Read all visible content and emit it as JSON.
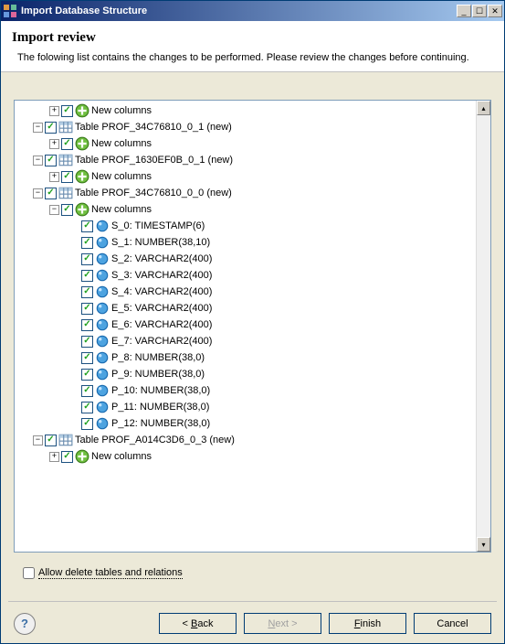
{
  "titlebar": {
    "title": "Import Database Structure"
  },
  "header": {
    "title": "Import review",
    "desc": "The folowing list contains the changes to be performed. Please review the changes before continuing."
  },
  "tree": [
    {
      "level": 2,
      "toggle": "+",
      "icon": "plus",
      "label": "New columns"
    },
    {
      "level": 1,
      "toggle": "-",
      "icon": "table",
      "label": "Table PROF_34C76810_0_1 (new)"
    },
    {
      "level": 2,
      "toggle": "+",
      "icon": "plus",
      "label": "New columns"
    },
    {
      "level": 1,
      "toggle": "-",
      "icon": "table",
      "label": "Table PROF_1630EF0B_0_1 (new)"
    },
    {
      "level": 2,
      "toggle": "+",
      "icon": "plus",
      "label": "New columns"
    },
    {
      "level": 1,
      "toggle": "-",
      "icon": "table",
      "label": "Table PROF_34C76810_0_0 (new)"
    },
    {
      "level": 2,
      "toggle": "-",
      "icon": "plus",
      "label": "New columns"
    },
    {
      "level": 3,
      "toggle": "",
      "icon": "column",
      "label": "S_0: TIMESTAMP(6)"
    },
    {
      "level": 3,
      "toggle": "",
      "icon": "column",
      "label": "S_1: NUMBER(38,10)"
    },
    {
      "level": 3,
      "toggle": "",
      "icon": "column",
      "label": "S_2: VARCHAR2(400)"
    },
    {
      "level": 3,
      "toggle": "",
      "icon": "column",
      "label": "S_3: VARCHAR2(400)"
    },
    {
      "level": 3,
      "toggle": "",
      "icon": "column",
      "label": "S_4: VARCHAR2(400)"
    },
    {
      "level": 3,
      "toggle": "",
      "icon": "column",
      "label": "E_5: VARCHAR2(400)"
    },
    {
      "level": 3,
      "toggle": "",
      "icon": "column",
      "label": "E_6: VARCHAR2(400)"
    },
    {
      "level": 3,
      "toggle": "",
      "icon": "column",
      "label": "E_7: VARCHAR2(400)"
    },
    {
      "level": 3,
      "toggle": "",
      "icon": "column",
      "label": "P_8: NUMBER(38,0)"
    },
    {
      "level": 3,
      "toggle": "",
      "icon": "column",
      "label": "P_9: NUMBER(38,0)"
    },
    {
      "level": 3,
      "toggle": "",
      "icon": "column",
      "label": "P_10: NUMBER(38,0)"
    },
    {
      "level": 3,
      "toggle": "",
      "icon": "column",
      "label": "P_11: NUMBER(38,0)"
    },
    {
      "level": 3,
      "toggle": "",
      "icon": "column",
      "label": "P_12: NUMBER(38,0)"
    },
    {
      "level": 1,
      "toggle": "-",
      "icon": "table",
      "label": "Table PROF_A014C3D6_0_3 (new)"
    },
    {
      "level": 2,
      "toggle": "+",
      "icon": "plus",
      "label": "New columns"
    }
  ],
  "allowDeleteLabel": "Allow delete tables and relations",
  "buttons": {
    "back": "< Back",
    "next": "Next >",
    "finish": "Finish",
    "cancel": "Cancel"
  }
}
